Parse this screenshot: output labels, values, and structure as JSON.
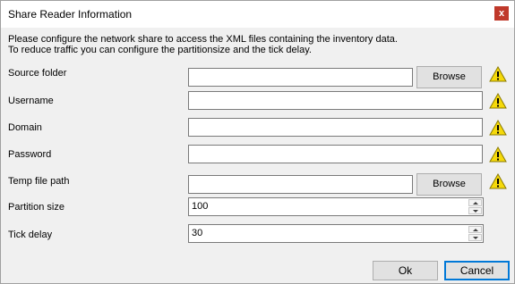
{
  "window": {
    "title": "Share Reader Information",
    "close_glyph": "x"
  },
  "description": {
    "line1": "Please configure the network share to access the XML files containing the inventory data.",
    "line2": "To reduce traffic you can configure the partitionsize and the tick delay."
  },
  "form": {
    "source_folder": {
      "label": "Source folder",
      "value": "",
      "browse_label": "Browse",
      "warning": true
    },
    "username": {
      "label": "Username",
      "value": "",
      "warning": true
    },
    "domain": {
      "label": "Domain",
      "value": "",
      "warning": true
    },
    "password": {
      "label": "Password",
      "value": "",
      "warning": true
    },
    "temp_file_path": {
      "label": "Temp file path",
      "value": "",
      "browse_label": "Browse",
      "warning": true
    },
    "partition_size": {
      "label": "Partition size",
      "value": "100"
    },
    "tick_delay": {
      "label": "Tick delay",
      "value": "30"
    }
  },
  "buttons": {
    "ok_label": "Ok",
    "cancel_label": "Cancel"
  },
  "colors": {
    "close_button": "#c0392b",
    "warning_fill": "#f5d90a",
    "default_button_border": "#0078d7"
  },
  "icons": {
    "warning": "warning-triangle-icon",
    "close": "close-icon"
  }
}
